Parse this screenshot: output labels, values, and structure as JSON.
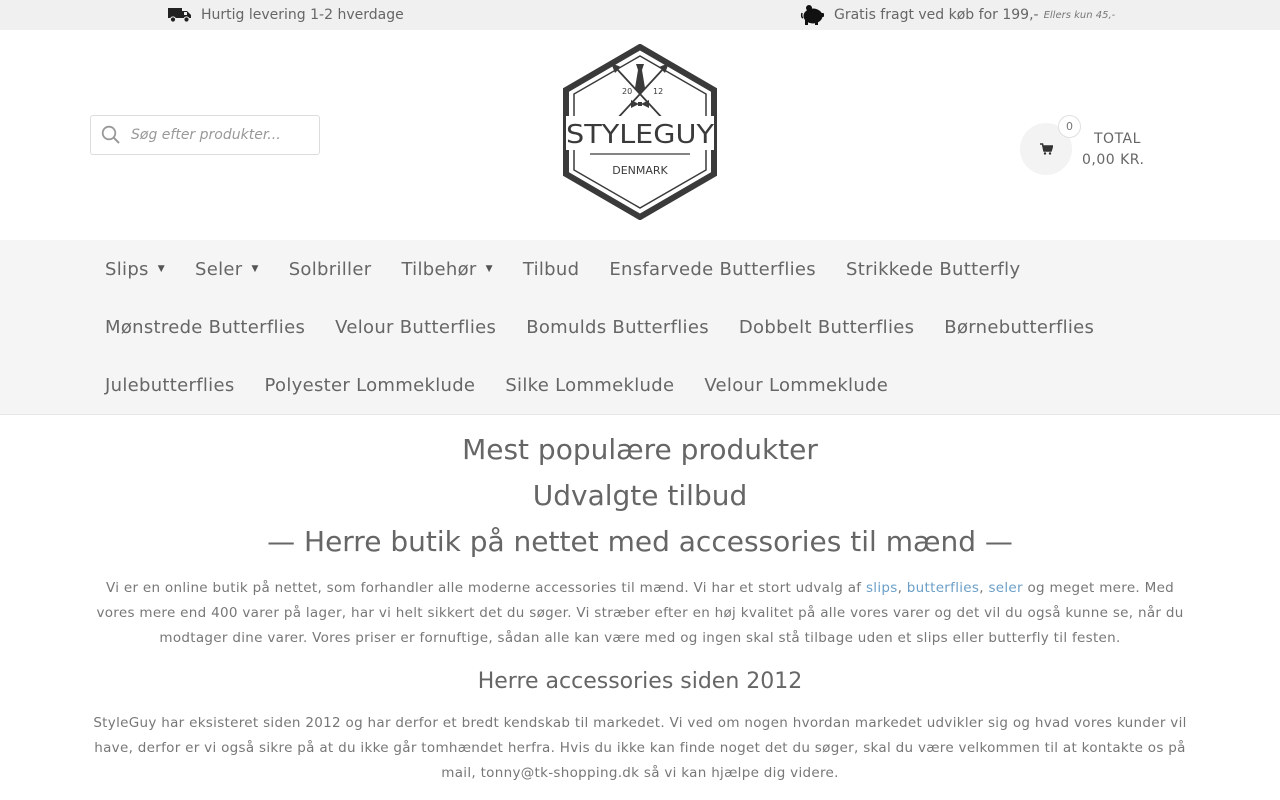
{
  "topbar": {
    "delivery_icon": "truck-icon",
    "delivery_text": "Hurtig levering 1-2 hverdage",
    "shipping_icon": "piggy-bank-icon",
    "shipping_text": "Gratis fragt ved køb for 199,-",
    "shipping_note": "Ellers kun 45,-"
  },
  "header": {
    "search_icon": "search-icon",
    "search_placeholder": "Søg efter produkter...",
    "logo": {
      "year_left": "20",
      "year_right": "12",
      "brand": "STYLEGUY",
      "country": "DENMARK"
    },
    "cart": {
      "icon": "cart-icon",
      "count": "0",
      "total_label": "TOTAL",
      "total_value": "0,00 KR."
    }
  },
  "nav": {
    "rows": [
      [
        {
          "label": "Slips",
          "dropdown": true
        },
        {
          "label": "Seler",
          "dropdown": true
        },
        {
          "label": "Solbriller",
          "dropdown": false
        },
        {
          "label": "Tilbehør",
          "dropdown": true
        },
        {
          "label": "Tilbud",
          "dropdown": false
        },
        {
          "label": "Ensfarvede Butterflies",
          "dropdown": false
        },
        {
          "label": "Strikkede Butterfly",
          "dropdown": false
        }
      ],
      [
        {
          "label": "Mønstrede Butterflies",
          "dropdown": false
        },
        {
          "label": "Velour Butterflies",
          "dropdown": false
        },
        {
          "label": "Bomulds Butterflies",
          "dropdown": false
        },
        {
          "label": "Dobbelt Butterflies",
          "dropdown": false
        },
        {
          "label": "Børnebutterflies",
          "dropdown": false
        }
      ],
      [
        {
          "label": "Julebutterflies",
          "dropdown": false
        },
        {
          "label": "Polyester Lommeklude",
          "dropdown": false
        },
        {
          "label": "Silke Lommeklude",
          "dropdown": false
        },
        {
          "label": "Velour Lommeklude",
          "dropdown": false
        }
      ]
    ]
  },
  "content": {
    "heading_popular": "Mest populære produkter",
    "heading_offers": "Udvalgte tilbud",
    "heading_shop": "— Herre butik på nettet med accessories til mænd —",
    "intro_before": "Vi er en online butik på nettet, som forhandler alle moderne accessories til mænd. Vi har et stort udvalg af ",
    "link_slips": "slips",
    "sep1": ", ",
    "link_butterflies": "butterflies",
    "sep2": ", ",
    "link_seler": "seler",
    "intro_after": " og meget mere. Med vores mere end 400 varer på lager, har vi helt sikkert det du søger. Vi stræber efter en høj kvalitet på alle vores varer og det vil du også kunne se, når du modtager dine varer. Vores priser er fornuftige, sådan alle kan være med og ingen skal stå tilbage uden et slips eller butterfly til festen.",
    "heading_since": "Herre accessories siden 2012",
    "about": "StyleGuy har eksisteret siden 2012 og har derfor et bredt kendskab til markedet. Vi ved om nogen hvordan markedet udvikler sig og hvad vores kunder vil have, derfor er vi også sikre på at du ikke går tomhændet herfra. Hvis du ikke kan finde noget det du søger, skal du være velkommen til at kontakte os på mail, tonny@tk-shopping.dk så vi kan hjælpe dig videre."
  },
  "colors": {
    "topbar_bg": "#f0f0f0",
    "nav_bg": "#f5f5f5",
    "link": "#6b9fc9",
    "text": "#666666"
  }
}
